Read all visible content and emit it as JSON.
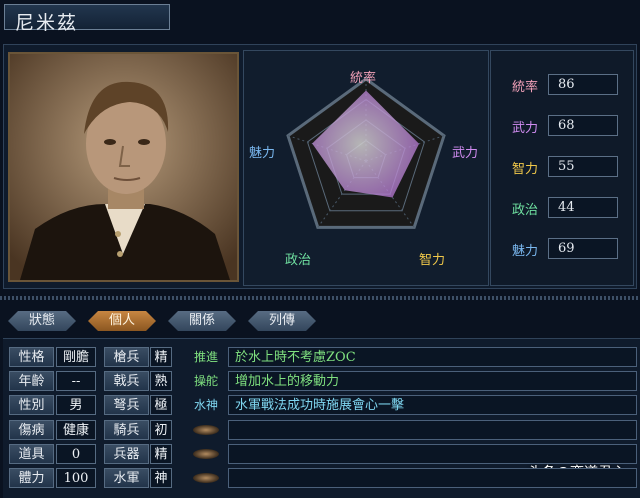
{
  "character": {
    "name": "尼米茲"
  },
  "radar": {
    "labels": {
      "top": "統率",
      "right": "武力",
      "bottom_right": "智力",
      "bottom_left": "政治",
      "left": "魅力"
    },
    "values": {
      "統率": 86,
      "武力": 68,
      "智力": 55,
      "政治": 44,
      "魅力": 69
    },
    "max": 100
  },
  "stats": [
    {
      "label": "統率",
      "value": "86",
      "color": "#f0a0b8"
    },
    {
      "label": "武力",
      "value": "68",
      "color": "#d08cf0"
    },
    {
      "label": "智力",
      "value": "55",
      "color": "#f0c84a"
    },
    {
      "label": "政治",
      "value": "44",
      "color": "#6fe0a0"
    },
    {
      "label": "魅力",
      "value": "69",
      "color": "#7ab8f0"
    }
  ],
  "tabs": [
    "狀態",
    "個人",
    "關係",
    "列傳"
  ],
  "active_tab": "個人",
  "profile": [
    {
      "label": "性格",
      "value": "剛膽"
    },
    {
      "label": "年齡",
      "value": "--"
    },
    {
      "label": "性別",
      "value": "男"
    },
    {
      "label": "傷病",
      "value": "健康"
    },
    {
      "label": "道具",
      "value": "0"
    },
    {
      "label": "體力",
      "value": "100"
    }
  ],
  "troops": [
    {
      "label": "槍兵",
      "value": "精"
    },
    {
      "label": "戟兵",
      "value": "熟"
    },
    {
      "label": "弩兵",
      "value": "極"
    },
    {
      "label": "騎兵",
      "value": "初"
    },
    {
      "label": "兵器",
      "value": "精"
    },
    {
      "label": "水軍",
      "value": "神"
    }
  ],
  "skills": [
    {
      "tag": "推進",
      "desc": "於水上時不考慮ZOC",
      "tag_color": "#7fe07f",
      "desc_color": "#7fe07f"
    },
    {
      "tag": "操舵",
      "desc": "增加水上的移動力",
      "tag_color": "#7fe07f",
      "desc_color": "#7fe07f"
    },
    {
      "tag": "水神",
      "desc": "水軍戰法成功時施展會心一擊",
      "tag_color": "#7fd6f0",
      "desc_color": "#7fd6f0"
    },
    {
      "tag": "",
      "desc": ""
    },
    {
      "tag": "",
      "desc": ""
    },
    {
      "tag": "",
      "desc": ""
    }
  ],
  "watermark": "头条@奕道君心"
}
